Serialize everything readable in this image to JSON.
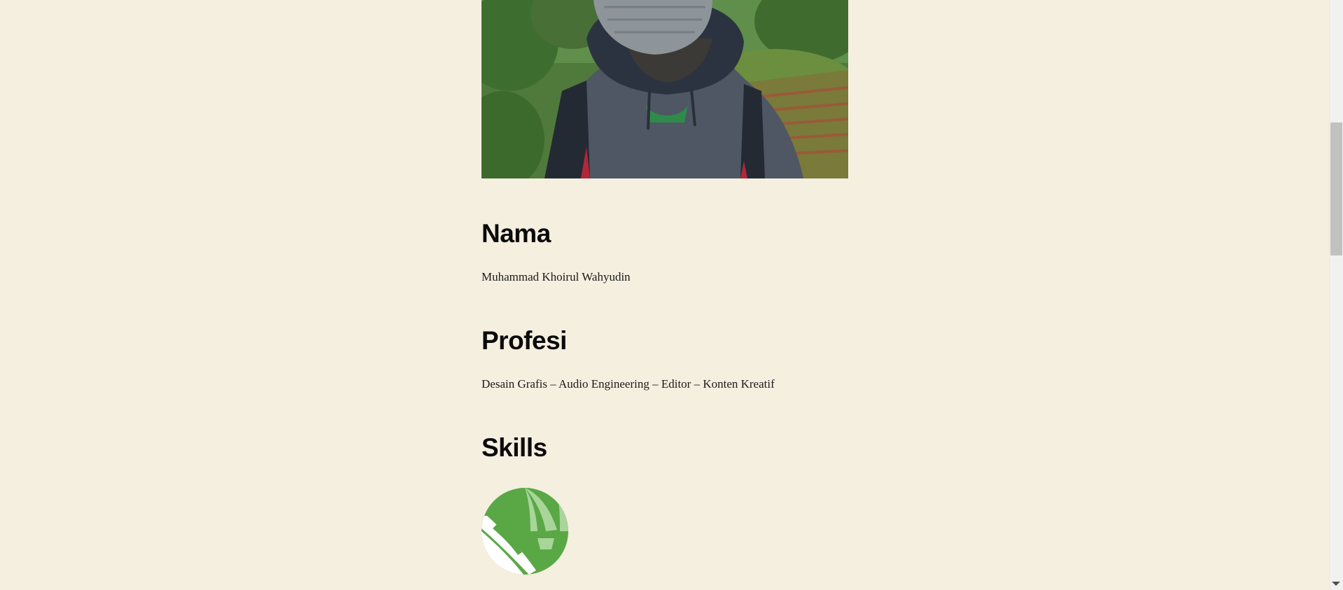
{
  "profile": {
    "photo_icon": "profile-photo-person-hoodie-mask"
  },
  "sections": {
    "nama": {
      "heading": "Nama",
      "text": "Muhammad Khoirul Wahyudin"
    },
    "profesi": {
      "heading": "Profesi",
      "text": "Desain Grafis – Audio Engineering – Editor – Konten Kreatif"
    },
    "skills": {
      "heading": "Skills",
      "icons": [
        "coreldraw-icon"
      ]
    }
  },
  "colors": {
    "background": "#f5efe0",
    "heading": "#0b0b0b",
    "text": "#1a1a1a",
    "skill_icon_green": "#5aa845"
  }
}
